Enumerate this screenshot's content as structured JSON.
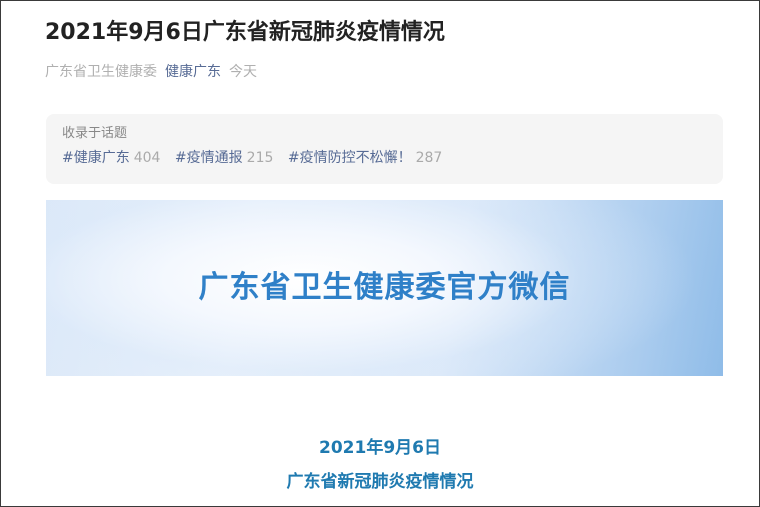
{
  "article": {
    "title": "2021年9月6日广东省新冠肺炎疫情情况",
    "source": "广东省卫生健康委",
    "author": "健康广东",
    "date": "今天"
  },
  "topics": {
    "label": "收录于话题",
    "items": [
      {
        "name": "#健康广东",
        "count": "404"
      },
      {
        "name": "#疫情通报",
        "count": "215"
      },
      {
        "name": "#疫情防控不松懈！",
        "count": "287"
      }
    ]
  },
  "banner": {
    "text": "广东省卫生健康委官方微信",
    "colors": {
      "text": "#2f80c8",
      "edge": "#8fbce8"
    }
  },
  "body": {
    "date_heading": "2021年9月6日",
    "title_heading": "广东省新冠肺炎疫情情况"
  },
  "colors": {
    "link": "#576b95",
    "accent": "#1f7ab0"
  }
}
